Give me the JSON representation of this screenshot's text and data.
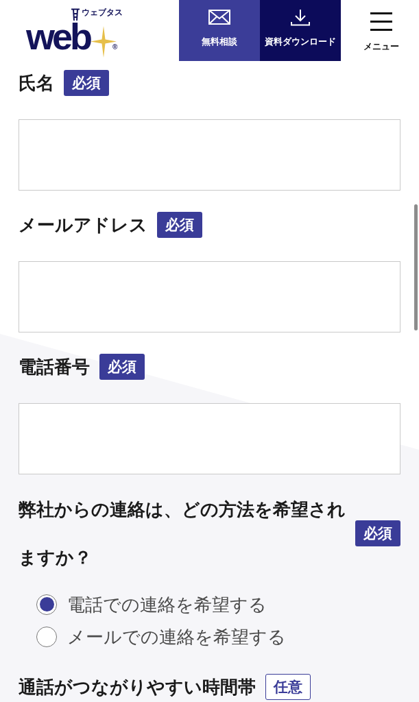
{
  "header": {
    "logo": {
      "wordmark": "web",
      "reading": "ウェブタス",
      "mark": "®"
    },
    "buttons": [
      {
        "label": "無料相談",
        "kind": "mail"
      },
      {
        "label": "資料ダウンロード",
        "kind": "download"
      }
    ],
    "menu": {
      "label": "メニュー"
    }
  },
  "fields": [
    {
      "label": "氏名",
      "badge": "必須",
      "required": true,
      "kind": "text"
    },
    {
      "label": "メールアドレス",
      "badge": "必須",
      "required": true,
      "kind": "text"
    },
    {
      "label": "電話番号",
      "badge": "必須",
      "required": true,
      "kind": "text"
    },
    {
      "label": "弊社からの連絡は、どの方法を希望されますか？",
      "badge": "必須",
      "required": true,
      "kind": "radio",
      "options": [
        {
          "label": "電話での連絡を希望する",
          "selected": true
        },
        {
          "label": "メールでの連絡を希望する",
          "selected": false
        }
      ]
    },
    {
      "label": "通話がつながりやすい時間帯",
      "badge": "任意",
      "required": false
    }
  ]
}
